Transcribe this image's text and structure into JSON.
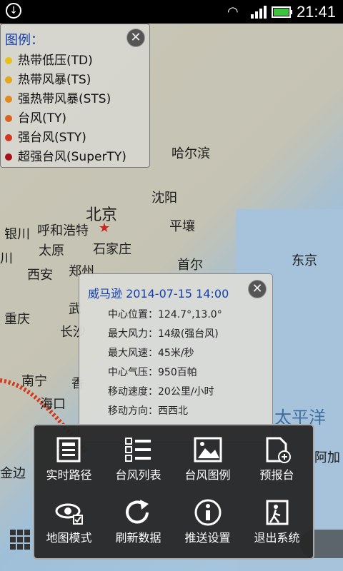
{
  "status_bar": {
    "time": "21:41"
  },
  "legend": {
    "title": "图例：",
    "items": [
      {
        "label": "热带低压(TD)",
        "color": "#e8c01a"
      },
      {
        "label": "热带风暴(TS)",
        "color": "#e4a818"
      },
      {
        "label": "强热带风暴(STS)",
        "color": "#e08a20"
      },
      {
        "label": "台风(TY)",
        "color": "#d86420"
      },
      {
        "label": "强台风(STY)",
        "color": "#d23a1e"
      },
      {
        "label": "超强台风(SuperTY)",
        "color": "#a8101a"
      }
    ]
  },
  "map": {
    "cities": {
      "harbin": "哈尔滨",
      "shenyang": "沈阳",
      "beijing": "北京",
      "hohhot": "呼和浩特",
      "yinchuan": "银川",
      "taiyuan": "太原",
      "shijiazhuang": "石家庄",
      "pyongyang": "平壤",
      "seoul": "首尔",
      "tokyo": "东京",
      "xian": "西安",
      "zhengzhou": "郑州",
      "chongqing": "重庆",
      "wuhan": "武",
      "changsha": "长沙",
      "nanning": "南宁",
      "xiang": "香",
      "haikou": "海口",
      "pacific": "太平洋",
      "ajia": "阿加",
      "jinbian": "金边",
      "chuan": "川"
    }
  },
  "info_popup": {
    "title": "威马逊 2014-07-15 14:00",
    "rows": [
      {
        "label": "中心位置：",
        "value": "124.7°,13.0°"
      },
      {
        "label": "最大风力：",
        "value": "14级(强台风)"
      },
      {
        "label": "最大风速：",
        "value": "45米/秒"
      },
      {
        "label": "中心气压：",
        "value": "950百帕"
      },
      {
        "label": "移动速度：",
        "value": "20公里/小时"
      },
      {
        "label": "移动方向：",
        "value": "西西北"
      }
    ]
  },
  "menu": {
    "items": [
      {
        "label": "实时路径",
        "icon": "realtime-path-icon"
      },
      {
        "label": "台风列表",
        "icon": "typhoon-list-icon"
      },
      {
        "label": "台风图例",
        "icon": "typhoon-legend-icon"
      },
      {
        "label": "预报台",
        "icon": "forecast-station-icon"
      },
      {
        "label": "地图模式",
        "icon": "map-mode-icon"
      },
      {
        "label": "刷新数据",
        "icon": "refresh-icon"
      },
      {
        "label": "推送设置",
        "icon": "push-settings-icon"
      },
      {
        "label": "退出系统",
        "icon": "exit-icon"
      }
    ]
  }
}
